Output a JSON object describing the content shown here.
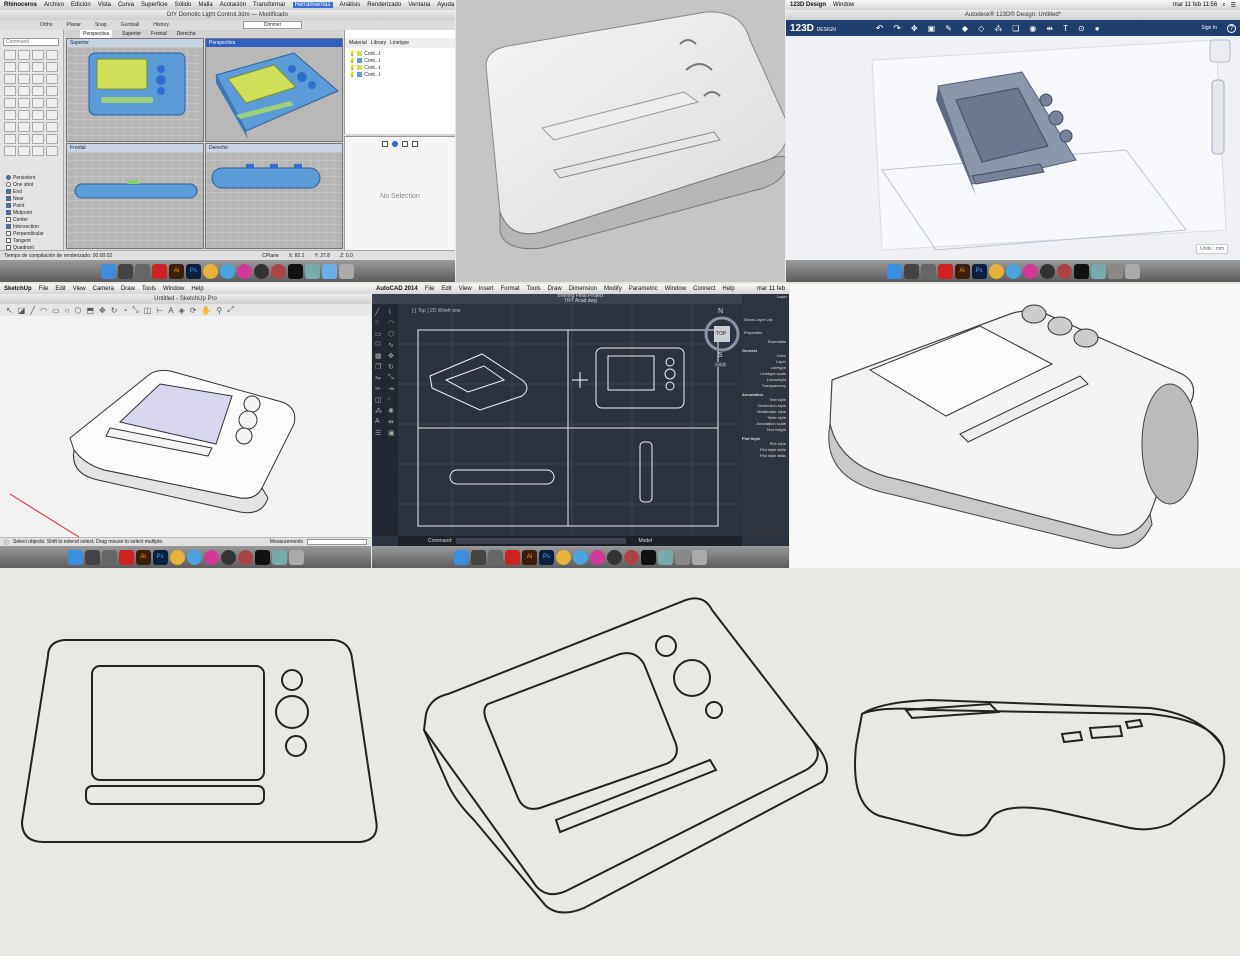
{
  "rhino": {
    "menu": [
      "Rhinoceros",
      "Archivo",
      "Edición",
      "Vista",
      "Curva",
      "Superficie",
      "Sólido",
      "Malla",
      "Acotación",
      "Transformar",
      "Herramientas",
      "Análisis",
      "Renderizado",
      "Ventana",
      "Ayuda"
    ],
    "title": "DIY Domotic Light Control.3dm — Modificado",
    "toolbar": [
      "Ortho",
      "Planar",
      "Snap",
      "Gumball",
      "History"
    ],
    "layer_select": "Dimmer",
    "command_placeholder": "Command",
    "tabs": [
      "Perspectiva",
      "Superior",
      "Frontal",
      "Derecha"
    ],
    "viewports": {
      "top": "Superior",
      "perspective": "Perspectiva",
      "front": "Frontal",
      "right": "Derecho"
    },
    "osnaps": [
      {
        "label": "Persistent",
        "type": "radio",
        "on": true
      },
      {
        "label": "One shot",
        "type": "radio",
        "on": false
      },
      {
        "label": "End",
        "type": "check",
        "on": true
      },
      {
        "label": "Near",
        "type": "check",
        "on": true
      },
      {
        "label": "Point",
        "type": "check",
        "on": true
      },
      {
        "label": "Midpoint",
        "type": "check",
        "on": true
      },
      {
        "label": "Center",
        "type": "check",
        "on": false
      },
      {
        "label": "Intersection",
        "type": "check",
        "on": true
      },
      {
        "label": "Perpendicular",
        "type": "check",
        "on": false
      },
      {
        "label": "Tangent",
        "type": "check",
        "on": false
      },
      {
        "label": "Quadrant",
        "type": "check",
        "on": false
      }
    ],
    "layers_header": [
      "Material",
      "Library",
      "Linetype"
    ],
    "layers": [
      "Cont...t",
      "Cont...t",
      "Cont...t",
      "Cont...t"
    ],
    "no_selection": "No Selection",
    "status": "Tiempo de compilación de renderizado: 00:00:02",
    "cplane": "CPlane",
    "coords": {
      "x": "X: 82.2",
      "y": "Y: 27.8",
      "z": "Z: 0.0"
    }
  },
  "design123d": {
    "menu": [
      "123D Design",
      "Window"
    ],
    "title": "Autodesk® 123D® Design: Untitled*",
    "logo_main": "123D",
    "logo_sub": "DESIGN",
    "sign_in": "Sign In",
    "help": "?",
    "units": "Units : mm",
    "clock": "mar 11 feb  11:56"
  },
  "sketchup": {
    "menu": [
      "SketchUp",
      "File",
      "Edit",
      "View",
      "Camera",
      "Draw",
      "Tools",
      "Window",
      "Help"
    ],
    "title": "Untitled - SketchUp Pro",
    "status": "Select objects. Shift to extend select. Drag mouse to select multiple.",
    "measurements_label": "Measurements"
  },
  "autocad": {
    "menu": [
      "AutoCAD 2014",
      "File",
      "Edit",
      "View",
      "Insert",
      "Format",
      "Tools",
      "Draw",
      "Dimension",
      "Modify",
      "Parametric",
      "Window",
      "Connect",
      "Help"
    ],
    "title1": "Briefing Final Project",
    "title2": "TRY Acad.dwg",
    "viewport_label": "[-] Top ] 2D Wireframe",
    "compass": {
      "n": "N",
      "s": "S",
      "top": "TOP",
      "wcs": "WCS"
    },
    "command_label": "Command:",
    "model_tab": "Model",
    "clock": "mar 11 feb",
    "layers_title": "Layer",
    "properties_title": "Properties",
    "show_layer_list": "Show Layer List",
    "essentials": "Essentials",
    "general_header": "General",
    "general": [
      "Color",
      "Layer",
      "Linetype",
      "Linetype scale",
      "Lineweight",
      "Transparency"
    ],
    "annotation_header": "Annotation",
    "annotation": [
      "Text style",
      "Dimension style",
      "Multileader style",
      "Table style",
      "Annotation scale",
      "Text height"
    ],
    "plot_header": "Plot Style",
    "plot": [
      "Plot style",
      "Plot style table",
      "Plot style attac"
    ]
  },
  "colors": {
    "rhino_blue": "#5b9bd8",
    "rhino_screen": "#cfe05a",
    "autocad_bg": "#2b3341",
    "design123d_bar": "#1f3d6d",
    "paper": "#e9e9e3"
  }
}
